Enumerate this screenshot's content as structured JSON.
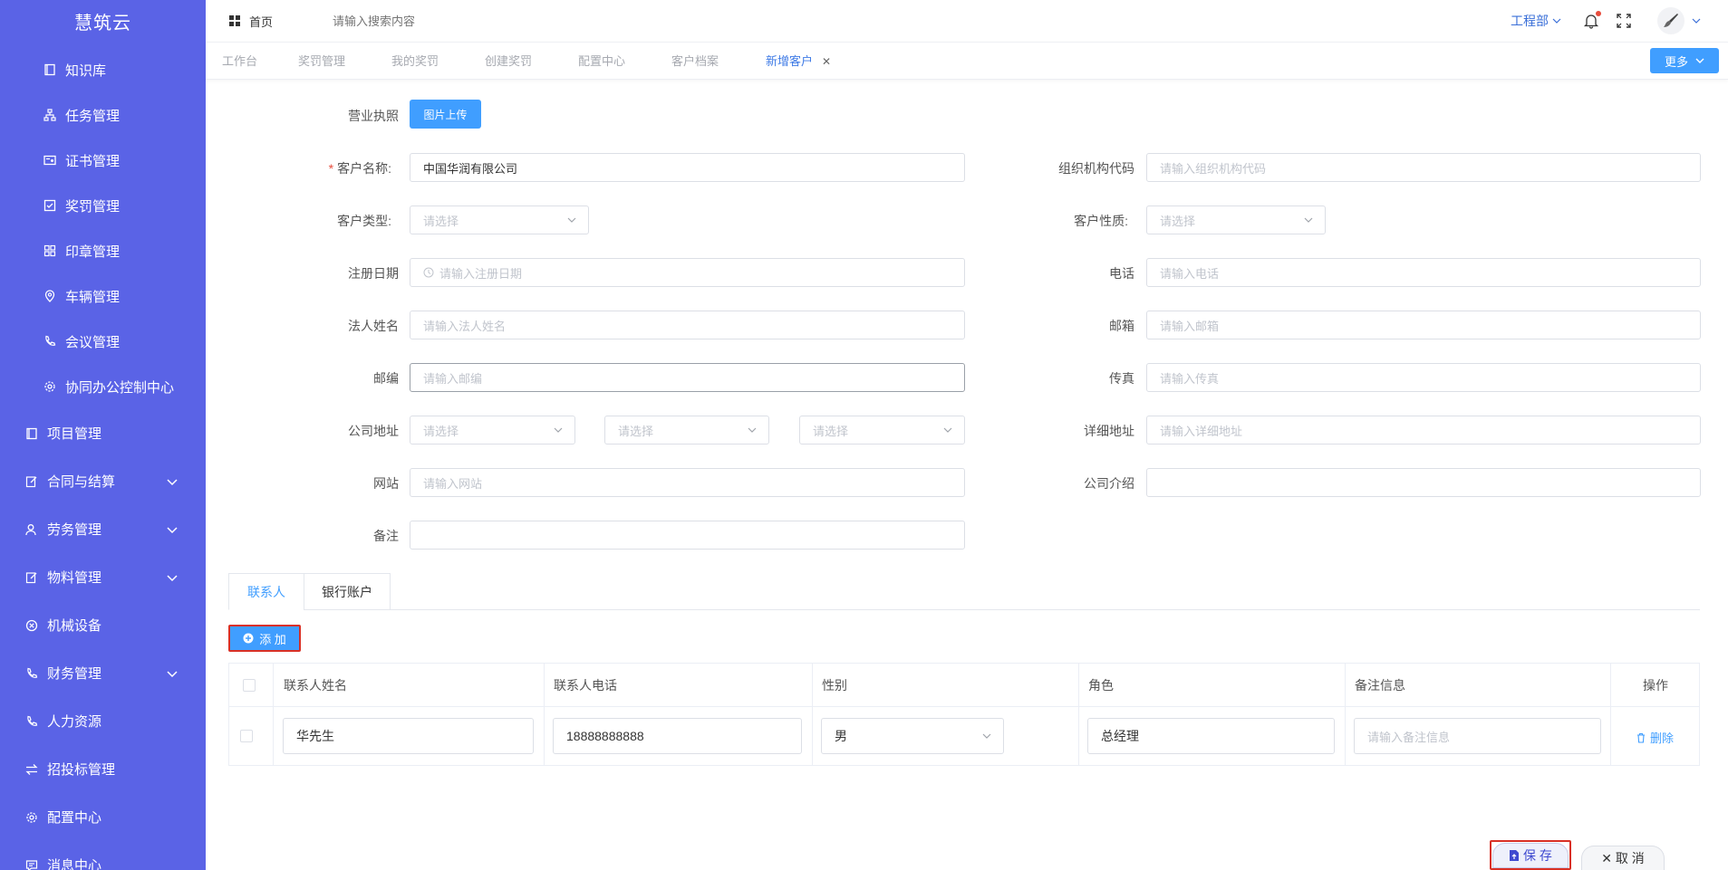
{
  "sidebar": {
    "brand": "慧筑云",
    "items": [
      {
        "label": "知识库",
        "icon": "book-icon"
      },
      {
        "label": "任务管理",
        "icon": "sitemap-icon"
      },
      {
        "label": "证书管理",
        "icon": "certificate-icon"
      },
      {
        "label": "奖罚管理",
        "icon": "checkbox-icon"
      },
      {
        "label": "印章管理",
        "icon": "grid-icon"
      },
      {
        "label": "车辆管理",
        "icon": "location-icon"
      },
      {
        "label": "会议管理",
        "icon": "phone-icon"
      },
      {
        "label": "协同办公控制中心",
        "icon": "gear-icon"
      },
      {
        "label": "项目管理",
        "icon": "book-icon"
      },
      {
        "label": "合同与结算",
        "icon": "edit-icon"
      },
      {
        "label": "劳务管理",
        "icon": "user-icon"
      },
      {
        "label": "物料管理",
        "icon": "edit-icon"
      },
      {
        "label": "机械设备",
        "icon": "close-circle-icon"
      },
      {
        "label": "财务管理",
        "icon": "phone-icon"
      },
      {
        "label": "人力资源",
        "icon": "phone-icon"
      },
      {
        "label": "招投标管理",
        "icon": "transfer-icon"
      },
      {
        "label": "配置中心",
        "icon": "gear-icon"
      },
      {
        "label": "消息中心",
        "icon": "message-icon"
      }
    ]
  },
  "header": {
    "home_label": "首页",
    "search_placeholder": "请输入搜索内容",
    "department": "工程部"
  },
  "tabs": [
    {
      "label": "工作台"
    },
    {
      "label": "奖罚管理"
    },
    {
      "label": "我的奖罚"
    },
    {
      "label": "创建奖罚"
    },
    {
      "label": "配置中心"
    },
    {
      "label": "客户档案"
    },
    {
      "label": "新增客户",
      "active": true
    }
  ],
  "tabs_more": "更多",
  "form": {
    "license_label": "营业执照",
    "upload_button": "图片上传",
    "customer_name_label": "客户名称:",
    "customer_name_value": "中国华润有限公司",
    "org_code_label": "组织机构代码",
    "org_code_placeholder": "请输入组织机构代码",
    "customer_type_label": "客户类型:",
    "customer_nature_label": "客户性质:",
    "select_placeholder": "请选择",
    "reg_date_label": "注册日期",
    "reg_date_placeholder": "请输入注册日期",
    "phone_label": "电话",
    "phone_placeholder": "请输入电话",
    "legal_label": "法人姓名",
    "legal_placeholder": "请输入法人姓名",
    "email_label": "邮箱",
    "email_placeholder": "请输入邮箱",
    "postcode_label": "邮编",
    "postcode_placeholder": "请输入邮编",
    "fax_label": "传真",
    "fax_placeholder": "请输入传真",
    "address_label": "公司地址",
    "detail_address_label": "详细地址",
    "detail_address_placeholder": "请输入详细地址",
    "website_label": "网站",
    "website_placeholder": "请输入网站",
    "intro_label": "公司介绍",
    "remark_label": "备注"
  },
  "contact_tabs": [
    {
      "label": "联系人",
      "active": true
    },
    {
      "label": "银行账户"
    }
  ],
  "add_button": "添 加",
  "table": {
    "headers": [
      "联系人姓名",
      "联系人电话",
      "性别",
      "角色",
      "备注信息",
      "操作"
    ],
    "rows": [
      {
        "name": "华先生",
        "phone": "18888888888",
        "gender": "男",
        "role": "总经理",
        "remark_placeholder": "请输入备注信息",
        "action": "删除"
      }
    ]
  },
  "footer": {
    "save": "保 存",
    "cancel": "✕ 取 消"
  },
  "colors": {
    "sidebar": "#5a63e6",
    "primary": "#409eff",
    "highlight": "#d93025"
  }
}
